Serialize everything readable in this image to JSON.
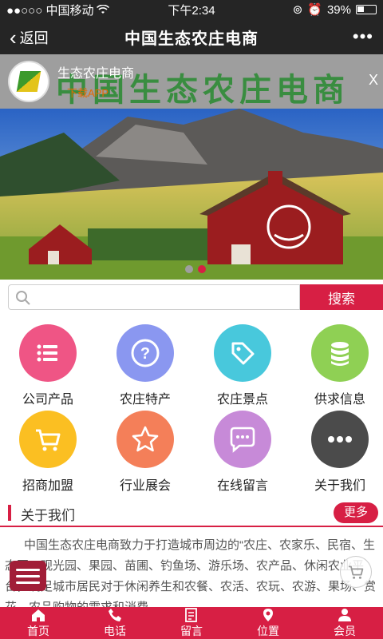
{
  "status_bar": {
    "carrier": "●●○○○ 中国移动",
    "time": "下午2:34",
    "battery": "39%"
  },
  "nav": {
    "back_label": "返回",
    "title": "中国生态农庄电商",
    "more": "•••"
  },
  "app_banner": {
    "name": "生态农庄电商",
    "download": "下载APP",
    "big_text": "中国生态农庄电商",
    "close": "X"
  },
  "carousel": {
    "total": 2,
    "active": 2
  },
  "search": {
    "placeholder": "",
    "button": "搜索"
  },
  "grid": [
    {
      "label": "公司产品",
      "color": "#ef5585",
      "icon": "list-icon"
    },
    {
      "label": "农庄特产",
      "color": "#8a97f0",
      "icon": "question-icon"
    },
    {
      "label": "农庄景点",
      "color": "#48c8dc",
      "icon": "tag-icon"
    },
    {
      "label": "供求信息",
      "color": "#8fd054",
      "icon": "database-icon"
    },
    {
      "label": "招商加盟",
      "color": "#fbbf22",
      "icon": "cart-icon"
    },
    {
      "label": "行业展会",
      "color": "#f47f59",
      "icon": "star-icon"
    },
    {
      "label": "在线留言",
      "color": "#c78ad8",
      "icon": "chat-icon"
    },
    {
      "label": "关于我们",
      "color": "#4b4b4b",
      "icon": "more-icon"
    }
  ],
  "about": {
    "title": "关于我们",
    "more": "更多",
    "text": "中国生态农庄电商致力于打造城市周边的“农庄、农家乐、民宿、生态园、观光园、果园、苗圃、钓鱼场、游乐场、农产品、休闲农业平台，满足城市居民对于休闲养生和农餐、农活、农玩、农游、果场、赏花、农品购物的需求和消费"
  },
  "bottom_nav": [
    {
      "label": "首页",
      "icon": "home-icon"
    },
    {
      "label": "电话",
      "icon": "phone-icon"
    },
    {
      "label": "留言",
      "icon": "message-icon"
    },
    {
      "label": "位置",
      "icon": "location-icon"
    },
    {
      "label": "会员",
      "icon": "user-icon"
    }
  ],
  "colors": {
    "accent": "#d71f44",
    "bar_bg": "#252525"
  }
}
